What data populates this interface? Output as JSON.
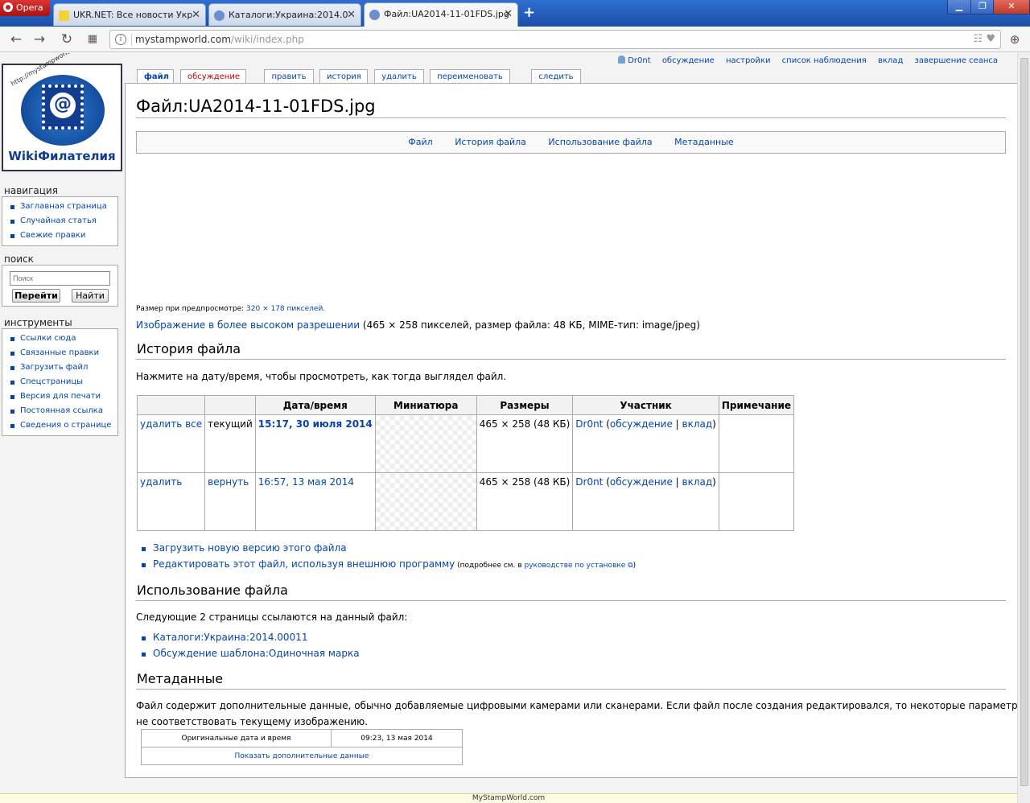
{
  "browser": {
    "menu_label": "Opera",
    "tabs": [
      {
        "title": "UKR.NET: Все новости Укр",
        "active": false
      },
      {
        "title": "Каталоги:Украина:2014.0",
        "active": false
      },
      {
        "title": "Файл:UA2014-11-01FDS.jpg",
        "active": true
      }
    ],
    "new_tab_icon": "plus-icon",
    "url_host": "mystampworld.com",
    "url_path": "/wiki/index.php"
  },
  "personal": {
    "user": "Dr0nt",
    "links": [
      "обсуждение",
      "настройки",
      "список наблюдения",
      "вклад",
      "завершение сеанса"
    ]
  },
  "ca_tabs": {
    "file": "файл",
    "talk": "обсуждение",
    "edit": "править",
    "history": "история",
    "delete": "удалить",
    "move": "переименовать",
    "watch": "следить"
  },
  "logo": {
    "text": "WikiФилателия",
    "url_text": "http://mystampworld.com/wiki"
  },
  "sidebar": {
    "navigation_title": "навигация",
    "navigation": [
      "Заглавная страница",
      "Случайная статья",
      "Свежие правки"
    ],
    "search_title": "поиск",
    "search_placeholder": "Поиск",
    "go_label": "Перейти",
    "find_label": "Найти",
    "tools_title": "инструменты",
    "tools": [
      "Ссылки сюда",
      "Связанные правки",
      "Загрузить файл",
      "Спецстраницы",
      "Версия для печати",
      "Постоянная ссылка",
      "Сведения о странице"
    ]
  },
  "page": {
    "title": "Файл:UA2014-11-01FDS.jpg",
    "filetoc": [
      "Файл",
      "История файла",
      "Использование файла",
      "Метаданные"
    ],
    "preview_label": "Размер при предпросмотре: ",
    "preview_link": "320 × 178 пикселей.",
    "hires_link": "Изображение в более высоком разрешении",
    "hires_info": " (465 × 258 пикселей, размер файла: 48 КБ, MIME-тип: image/jpeg)",
    "history_heading": "История файла",
    "history_hint": "Нажмите на дату/время, чтобы просмотреть, как тогда выглядел файл.",
    "history_headers": [
      "",
      "",
      "Дата/время",
      "Миниатюра",
      "Размеры",
      "Участник",
      "Примечание"
    ],
    "history_rows": [
      {
        "action": "удалить все",
        "status": "текущий",
        "date": "15:17, 30 июля 2014",
        "size": "465 × 258 (48 КБ)",
        "user": "Dr0nt",
        "talk": "обсуждение",
        "contribs": "вклад"
      },
      {
        "action": "удалить",
        "status": "вернуть",
        "date": "16:57, 13 мая 2014",
        "size": "465 × 258 (48 КБ)",
        "user": "Dr0nt",
        "talk": "обсуждение",
        "contribs": "вклад"
      }
    ],
    "upload_new": "Загрузить новую версию этого файла",
    "edit_external": "Редактировать этот файл, используя внешнюю программу",
    "edit_external_note": " (подробнее см. в ",
    "edit_external_link": "руководстве по установке",
    "edit_external_close": ")",
    "usage_heading": "Использование файла",
    "usage_text": "Следующие 2 страницы ссылаются на данный файл:",
    "usage_links": [
      "Каталоги:Украина:2014.00011",
      "Обсуждение шаблона:Одиночная марка"
    ],
    "meta_heading": "Метаданные",
    "meta_text_1": "Файл содержит дополнительные данные, обычно добавляемые цифровыми камерами или сканерами. Если файл после создания редактировался, то некоторые параметры могут",
    "meta_text_2": "не соответствовать текущему изображению.",
    "meta_row_label": "Оригинальные дата и время",
    "meta_row_value": "09:23, 13 мая 2014",
    "meta_show_more": "Показать дополнительные данные"
  },
  "footer": {
    "text": "MyStampWorld.com"
  }
}
